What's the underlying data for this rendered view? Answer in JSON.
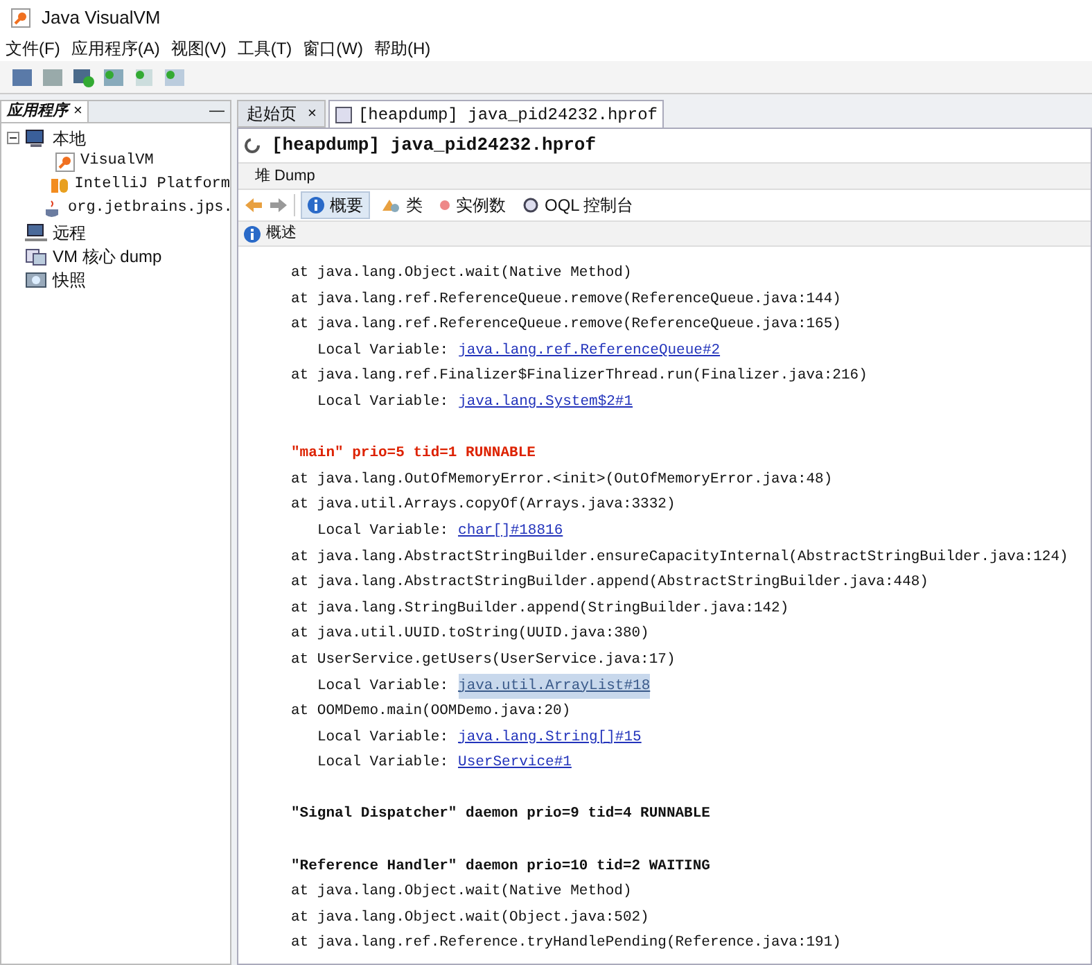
{
  "window": {
    "title": "Java VisualVM"
  },
  "menu": [
    "文件(F)",
    "应用程序(A)",
    "视图(V)",
    "工具(T)",
    "窗口(W)",
    "帮助(H)"
  ],
  "sidebar": {
    "tab": "应用程序",
    "close": "×",
    "minimize": "—",
    "tree": [
      {
        "label": "本地",
        "kind": "computer",
        "expanded": true,
        "children": [
          {
            "label": "VisualVM",
            "kind": "app"
          },
          {
            "label": "IntelliJ Platform",
            "kind": "jb"
          },
          {
            "label": "org.jetbrains.jps.",
            "kind": "cup"
          }
        ]
      },
      {
        "label": "远程",
        "kind": "remote"
      },
      {
        "label": "VM 核心 dump",
        "kind": "dump"
      },
      {
        "label": "快照",
        "kind": "snapshot"
      }
    ]
  },
  "tabs": [
    {
      "label": "起始页",
      "close": "×",
      "selected": false
    },
    {
      "label": "[heapdump] java_pid24232.hprof",
      "selected": true
    }
  ],
  "heading": "[heapdump] java_pid24232.hprof",
  "section": "堆 Dump",
  "views": [
    {
      "label": "概要",
      "kind": "info",
      "selected": true
    },
    {
      "label": "类",
      "kind": "classes",
      "selected": false
    },
    {
      "label": "实例数",
      "kind": "dot",
      "selected": false
    },
    {
      "label": "OQL 控制台",
      "kind": "oql",
      "selected": false
    }
  ],
  "subheading": "概述",
  "lines": [
    {
      "kind": "frame",
      "text": "at java.lang.Object.wait(Native Method)"
    },
    {
      "kind": "frame",
      "text": "at java.lang.ref.ReferenceQueue.remove(ReferenceQueue.java:144)"
    },
    {
      "kind": "frame",
      "text": "at java.lang.ref.ReferenceQueue.remove(ReferenceQueue.java:165)"
    },
    {
      "kind": "local",
      "label": "Local Variable:",
      "link": "java.lang.ref.ReferenceQueue#2",
      "selected": false
    },
    {
      "kind": "frame",
      "text": "at java.lang.ref.Finalizer$FinalizerThread.run(Finalizer.java:216)"
    },
    {
      "kind": "local",
      "label": "Local Variable:",
      "link": "java.lang.System$2#1",
      "selected": false
    },
    {
      "kind": "blank"
    },
    {
      "kind": "header",
      "text": "\"main\" prio=5 tid=1 RUNNABLE",
      "color": "#dd2200"
    },
    {
      "kind": "frame",
      "text": "at java.lang.OutOfMemoryError.<init>(OutOfMemoryError.java:48)"
    },
    {
      "kind": "frame",
      "text": "at java.util.Arrays.copyOf(Arrays.java:3332)"
    },
    {
      "kind": "local",
      "label": "Local Variable:",
      "link": "char[]#18816",
      "selected": false
    },
    {
      "kind": "frame",
      "text": "at java.lang.AbstractStringBuilder.ensureCapacityInternal(AbstractStringBuilder.java:124)"
    },
    {
      "kind": "frame",
      "text": "at java.lang.AbstractStringBuilder.append(AbstractStringBuilder.java:448)"
    },
    {
      "kind": "frame",
      "text": "at java.lang.StringBuilder.append(StringBuilder.java:142)"
    },
    {
      "kind": "frame",
      "text": "at java.util.UUID.toString(UUID.java:380)"
    },
    {
      "kind": "frame",
      "text": "at UserService.getUsers(UserService.java:17)"
    },
    {
      "kind": "local",
      "label": "Local Variable:",
      "link": "java.util.ArrayList#18",
      "selected": true
    },
    {
      "kind": "frame",
      "text": "at OOMDemo.main(OOMDemo.java:20)"
    },
    {
      "kind": "local",
      "label": "Local Variable:",
      "link": "java.lang.String[]#15",
      "selected": false
    },
    {
      "kind": "local",
      "label": "Local Variable:",
      "link": "UserService#1",
      "selected": false
    },
    {
      "kind": "blank"
    },
    {
      "kind": "header",
      "text": "\"Signal Dispatcher\" daemon prio=9 tid=4 RUNNABLE",
      "color": "#111111"
    },
    {
      "kind": "blank"
    },
    {
      "kind": "header",
      "text": "\"Reference Handler\" daemon prio=10 tid=2 WAITING",
      "color": "#111111"
    },
    {
      "kind": "frame",
      "text": "at java.lang.Object.wait(Native Method)"
    },
    {
      "kind": "frame",
      "text": "at java.lang.Object.wait(Object.java:502)"
    },
    {
      "kind": "frame",
      "text": "at java.lang.ref.Reference.tryHandlePending(Reference.java:191)"
    }
  ]
}
